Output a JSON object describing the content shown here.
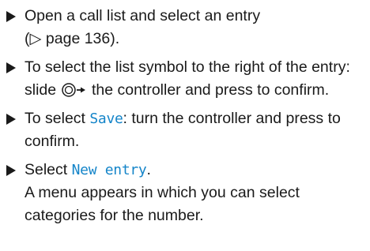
{
  "steps": [
    {
      "line1": "Open a call list and select an entry",
      "line2": "(▷ page 136)."
    },
    {
      "part1": "To select the list symbol to the right of the entry: slide",
      "part2": "the controller and press to confirm.",
      "controller_icon": "controller-slide-right-icon"
    },
    {
      "before": "To select",
      "highlight": "Save",
      "after": ": turn the controller and press to confirm."
    },
    {
      "before": "Select",
      "highlight": "New entry",
      "after": ".",
      "result": "A menu appears in which you can select categories for the number."
    }
  ],
  "colors": {
    "text": "#1a1a1a",
    "highlight": "#1585c9"
  }
}
